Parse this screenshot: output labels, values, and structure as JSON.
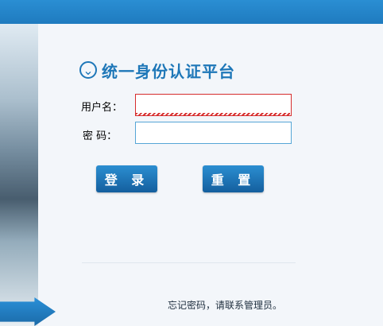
{
  "header": {
    "title": "统一身份认证平台",
    "title_icon": "chevron-down-circle-icon"
  },
  "form": {
    "username_label": "用户名：",
    "password_label": "密 码：",
    "username_value": "",
    "password_value": "",
    "login_button": "登 录",
    "reset_button": "重 置"
  },
  "footer": {
    "forgot_text": "忘记密码，请联系管理员。"
  },
  "colors": {
    "accent": "#1e77b8",
    "topbar": "#2388cf",
    "error": "#d62d2d"
  }
}
